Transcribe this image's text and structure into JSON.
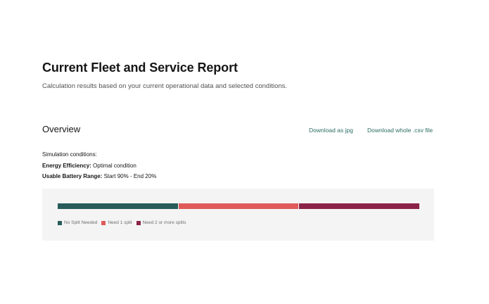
{
  "header": {
    "title": "Current Fleet and Service Report",
    "subtitle": "Calculation results based on your current operational data and selected conditions."
  },
  "overview": {
    "heading": "Overview",
    "download_jpg_label": "Download as jpg",
    "download_csv_label": "Download whole .csv file"
  },
  "conditions": {
    "heading": "Simulation conditions:",
    "energy_label": "Energy Efficiency:",
    "energy_value": "Optimal condition",
    "battery_label": "Usable Battery Range:",
    "battery_value": "Start 90% - End 20%"
  },
  "chart_data": {
    "type": "bar",
    "orientation": "horizontal-stacked",
    "series": [
      {
        "name": "No Split Needed",
        "value": 1,
        "color": "#275c5a"
      },
      {
        "name": "Need 1 split",
        "value": 1,
        "color": "#e05a5a"
      },
      {
        "name": "Need 2 or more splits",
        "value": 1,
        "color": "#8b2349"
      }
    ],
    "legend": "bottom-left"
  }
}
